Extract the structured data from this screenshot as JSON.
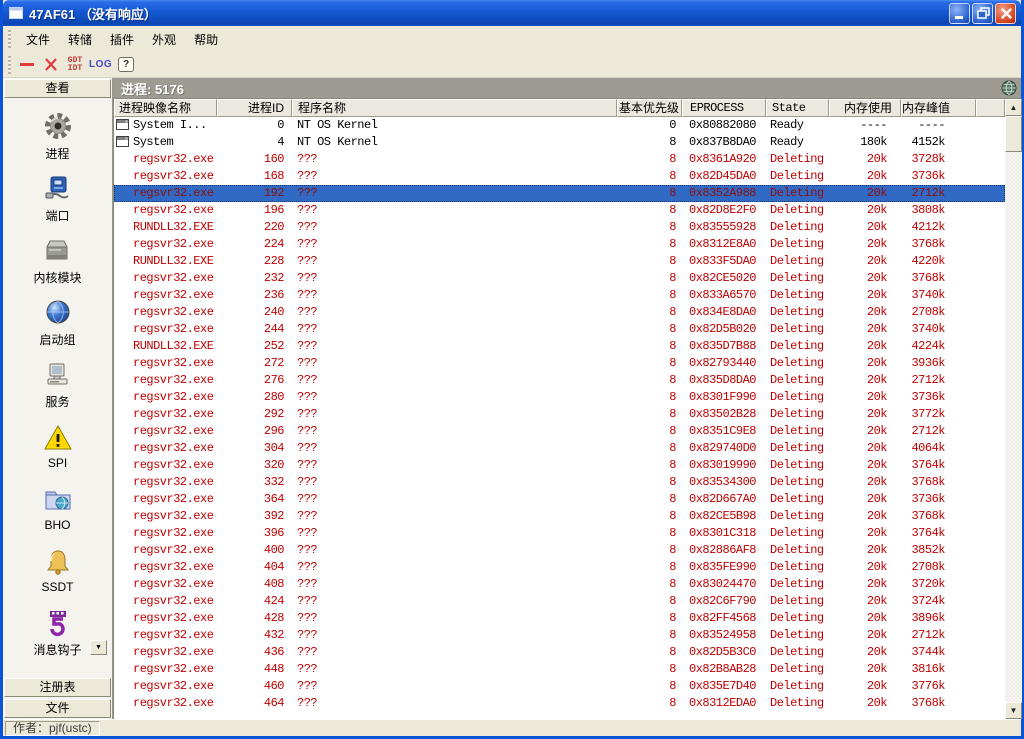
{
  "window": {
    "title": "47AF61 （没有响应）"
  },
  "menu": {
    "items": [
      "文件",
      "转储",
      "插件",
      "外观",
      "帮助"
    ]
  },
  "toolbar": {
    "gdt": "GDT",
    "idt": "IDT",
    "log": "LOG",
    "help": "?"
  },
  "sidebar": {
    "header": "查看",
    "items": [
      {
        "label": "进程",
        "icon": "gear-icon"
      },
      {
        "label": "端口",
        "icon": "port-icon"
      },
      {
        "label": "内核模块",
        "icon": "kernel-module-icon"
      },
      {
        "label": "启动组",
        "icon": "startup-globe-icon"
      },
      {
        "label": "服务",
        "icon": "services-computer-icon"
      },
      {
        "label": "SPI",
        "icon": "warning-triangle-icon"
      },
      {
        "label": "BHO",
        "icon": "folder-globe-icon"
      },
      {
        "label": "SSDT",
        "icon": "bell-icon"
      },
      {
        "label": "消息钩子",
        "icon": "message-hook-icon",
        "has_dropdown": true
      }
    ],
    "bottom_buttons": [
      "注册表",
      "文件"
    ]
  },
  "content": {
    "header": "进程: 5176",
    "table": {
      "columns": [
        "进程映像名称",
        "进程ID",
        "程序名称",
        "基本优先级",
        "EPROCESS",
        "State",
        "内存使用",
        "内存峰值"
      ],
      "rows": [
        {
          "image": "System I...",
          "pid": "0",
          "program": "NT OS Kernel",
          "priority": "0",
          "eprocess": "0x80882080",
          "state": "Ready",
          "mem": "----",
          "peak": "----",
          "kind": "black",
          "has_icon": true,
          "selected": false
        },
        {
          "image": "System",
          "pid": "4",
          "program": "NT OS Kernel",
          "priority": "8",
          "eprocess": "0x837B8DA0",
          "state": "Ready",
          "mem": "180k",
          "peak": "4152k",
          "kind": "black",
          "has_icon": true,
          "selected": false
        },
        {
          "image": "regsvr32.exe",
          "pid": "160",
          "program": "???",
          "priority": "8",
          "eprocess": "0x8361A920",
          "state": "Deleting",
          "mem": "20k",
          "peak": "3728k",
          "kind": "red",
          "has_icon": false,
          "selected": false
        },
        {
          "image": "regsvr32.exe",
          "pid": "168",
          "program": "???",
          "priority": "8",
          "eprocess": "0x82D45DA0",
          "state": "Deleting",
          "mem": "20k",
          "peak": "3736k",
          "kind": "red",
          "has_icon": false,
          "selected": false
        },
        {
          "image": "regsvr32.exe",
          "pid": "192",
          "program": "???",
          "priority": "8",
          "eprocess": "0x8352A988",
          "state": "Deleting",
          "mem": "20k",
          "peak": "2712k",
          "kind": "red",
          "has_icon": false,
          "selected": true
        },
        {
          "image": "regsvr32.exe",
          "pid": "196",
          "program": "???",
          "priority": "8",
          "eprocess": "0x82D8E2F0",
          "state": "Deleting",
          "mem": "20k",
          "peak": "3808k",
          "kind": "red",
          "has_icon": false,
          "selected": false
        },
        {
          "image": "RUNDLL32.EXE",
          "pid": "220",
          "program": "???",
          "priority": "8",
          "eprocess": "0x83555928",
          "state": "Deleting",
          "mem": "20k",
          "peak": "4212k",
          "kind": "red",
          "has_icon": false,
          "selected": false
        },
        {
          "image": "regsvr32.exe",
          "pid": "224",
          "program": "???",
          "priority": "8",
          "eprocess": "0x8312E8A0",
          "state": "Deleting",
          "mem": "20k",
          "peak": "3768k",
          "kind": "red",
          "has_icon": false,
          "selected": false
        },
        {
          "image": "RUNDLL32.EXE",
          "pid": "228",
          "program": "???",
          "priority": "8",
          "eprocess": "0x833F5DA0",
          "state": "Deleting",
          "mem": "20k",
          "peak": "4220k",
          "kind": "red",
          "has_icon": false,
          "selected": false
        },
        {
          "image": "regsvr32.exe",
          "pid": "232",
          "program": "???",
          "priority": "8",
          "eprocess": "0x82CE5020",
          "state": "Deleting",
          "mem": "20k",
          "peak": "3768k",
          "kind": "red",
          "has_icon": false,
          "selected": false
        },
        {
          "image": "regsvr32.exe",
          "pid": "236",
          "program": "???",
          "priority": "8",
          "eprocess": "0x833A6570",
          "state": "Deleting",
          "mem": "20k",
          "peak": "3740k",
          "kind": "red",
          "has_icon": false,
          "selected": false
        },
        {
          "image": "regsvr32.exe",
          "pid": "240",
          "program": "???",
          "priority": "8",
          "eprocess": "0x834E8DA0",
          "state": "Deleting",
          "mem": "20k",
          "peak": "2708k",
          "kind": "red",
          "has_icon": false,
          "selected": false
        },
        {
          "image": "regsvr32.exe",
          "pid": "244",
          "program": "???",
          "priority": "8",
          "eprocess": "0x82D5B020",
          "state": "Deleting",
          "mem": "20k",
          "peak": "3740k",
          "kind": "red",
          "has_icon": false,
          "selected": false
        },
        {
          "image": "RUNDLL32.EXE",
          "pid": "252",
          "program": "???",
          "priority": "8",
          "eprocess": "0x835D7B88",
          "state": "Deleting",
          "mem": "20k",
          "peak": "4224k",
          "kind": "red",
          "has_icon": false,
          "selected": false
        },
        {
          "image": "regsvr32.exe",
          "pid": "272",
          "program": "???",
          "priority": "8",
          "eprocess": "0x82793440",
          "state": "Deleting",
          "mem": "20k",
          "peak": "3936k",
          "kind": "red",
          "has_icon": false,
          "selected": false
        },
        {
          "image": "regsvr32.exe",
          "pid": "276",
          "program": "???",
          "priority": "8",
          "eprocess": "0x835D8DA0",
          "state": "Deleting",
          "mem": "20k",
          "peak": "2712k",
          "kind": "red",
          "has_icon": false,
          "selected": false
        },
        {
          "image": "regsvr32.exe",
          "pid": "280",
          "program": "???",
          "priority": "8",
          "eprocess": "0x8301F990",
          "state": "Deleting",
          "mem": "20k",
          "peak": "3736k",
          "kind": "red",
          "has_icon": false,
          "selected": false
        },
        {
          "image": "regsvr32.exe",
          "pid": "292",
          "program": "???",
          "priority": "8",
          "eprocess": "0x83502B28",
          "state": "Deleting",
          "mem": "20k",
          "peak": "3772k",
          "kind": "red",
          "has_icon": false,
          "selected": false
        },
        {
          "image": "regsvr32.exe",
          "pid": "296",
          "program": "???",
          "priority": "8",
          "eprocess": "0x8351C9E8",
          "state": "Deleting",
          "mem": "20k",
          "peak": "2712k",
          "kind": "red",
          "has_icon": false,
          "selected": false
        },
        {
          "image": "regsvr32.exe",
          "pid": "304",
          "program": "???",
          "priority": "8",
          "eprocess": "0x829740D0",
          "state": "Deleting",
          "mem": "20k",
          "peak": "4064k",
          "kind": "red",
          "has_icon": false,
          "selected": false
        },
        {
          "image": "regsvr32.exe",
          "pid": "320",
          "program": "???",
          "priority": "8",
          "eprocess": "0x83019990",
          "state": "Deleting",
          "mem": "20k",
          "peak": "3764k",
          "kind": "red",
          "has_icon": false,
          "selected": false
        },
        {
          "image": "regsvr32.exe",
          "pid": "332",
          "program": "???",
          "priority": "8",
          "eprocess": "0x83534300",
          "state": "Deleting",
          "mem": "20k",
          "peak": "3768k",
          "kind": "red",
          "has_icon": false,
          "selected": false
        },
        {
          "image": "regsvr32.exe",
          "pid": "364",
          "program": "???",
          "priority": "8",
          "eprocess": "0x82D667A0",
          "state": "Deleting",
          "mem": "20k",
          "peak": "3736k",
          "kind": "red",
          "has_icon": false,
          "selected": false
        },
        {
          "image": "regsvr32.exe",
          "pid": "392",
          "program": "???",
          "priority": "8",
          "eprocess": "0x82CE5B98",
          "state": "Deleting",
          "mem": "20k",
          "peak": "3768k",
          "kind": "red",
          "has_icon": false,
          "selected": false
        },
        {
          "image": "regsvr32.exe",
          "pid": "396",
          "program": "???",
          "priority": "8",
          "eprocess": "0x8301C318",
          "state": "Deleting",
          "mem": "20k",
          "peak": "3764k",
          "kind": "red",
          "has_icon": false,
          "selected": false
        },
        {
          "image": "regsvr32.exe",
          "pid": "400",
          "program": "???",
          "priority": "8",
          "eprocess": "0x82886AF8",
          "state": "Deleting",
          "mem": "20k",
          "peak": "3852k",
          "kind": "red",
          "has_icon": false,
          "selected": false
        },
        {
          "image": "regsvr32.exe",
          "pid": "404",
          "program": "???",
          "priority": "8",
          "eprocess": "0x835FE990",
          "state": "Deleting",
          "mem": "20k",
          "peak": "2708k",
          "kind": "red",
          "has_icon": false,
          "selected": false
        },
        {
          "image": "regsvr32.exe",
          "pid": "408",
          "program": "???",
          "priority": "8",
          "eprocess": "0x83024470",
          "state": "Deleting",
          "mem": "20k",
          "peak": "3720k",
          "kind": "red",
          "has_icon": false,
          "selected": false
        },
        {
          "image": "regsvr32.exe",
          "pid": "424",
          "program": "???",
          "priority": "8",
          "eprocess": "0x82C6F790",
          "state": "Deleting",
          "mem": "20k",
          "peak": "3724k",
          "kind": "red",
          "has_icon": false,
          "selected": false
        },
        {
          "image": "regsvr32.exe",
          "pid": "428",
          "program": "???",
          "priority": "8",
          "eprocess": "0x82FF4568",
          "state": "Deleting",
          "mem": "20k",
          "peak": "3896k",
          "kind": "red",
          "has_icon": false,
          "selected": false
        },
        {
          "image": "regsvr32.exe",
          "pid": "432",
          "program": "???",
          "priority": "8",
          "eprocess": "0x83524958",
          "state": "Deleting",
          "mem": "20k",
          "peak": "2712k",
          "kind": "red",
          "has_icon": false,
          "selected": false
        },
        {
          "image": "regsvr32.exe",
          "pid": "436",
          "program": "???",
          "priority": "8",
          "eprocess": "0x82D5B3C0",
          "state": "Deleting",
          "mem": "20k",
          "peak": "3744k",
          "kind": "red",
          "has_icon": false,
          "selected": false
        },
        {
          "image": "regsvr32.exe",
          "pid": "448",
          "program": "???",
          "priority": "8",
          "eprocess": "0x82B8AB28",
          "state": "Deleting",
          "mem": "20k",
          "peak": "3816k",
          "kind": "red",
          "has_icon": false,
          "selected": false
        },
        {
          "image": "regsvr32.exe",
          "pid": "460",
          "program": "???",
          "priority": "8",
          "eprocess": "0x835E7D40",
          "state": "Deleting",
          "mem": "20k",
          "peak": "3776k",
          "kind": "red",
          "has_icon": false,
          "selected": false
        },
        {
          "image": "regsvr32.exe",
          "pid": "464",
          "program": "???",
          "priority": "8",
          "eprocess": "0x8312EDA0",
          "state": "Deleting",
          "mem": "20k",
          "peak": "3768k",
          "kind": "red",
          "has_icon": false,
          "selected": false
        }
      ]
    }
  },
  "statusbar": {
    "author": "作者：pjf(ustc)"
  },
  "colors": {
    "alert_text": "#c00000",
    "selection_bg": "#316ac5",
    "titlebar_blue": "#1558d4",
    "band_gray": "#9d9b92"
  }
}
